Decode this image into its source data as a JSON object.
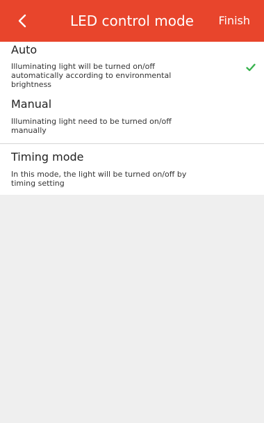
{
  "header": {
    "back_icon": "chevron-left-icon",
    "title": "LED control mode",
    "finish_label": "Finish",
    "background": "#e8452c"
  },
  "options": [
    {
      "title": "Auto",
      "description": "Illuminating light will be turned on/off automatically according to environmental brightness",
      "selected": true,
      "check_icon": "checkmark-icon",
      "check_color": "#37b24d"
    },
    {
      "title": "Manual",
      "description": "Illuminating light need to be turned on/off manually",
      "selected": false
    },
    {
      "title": "Timing mode",
      "description": "In this mode, the light will be turned on/off by timing setting",
      "selected": false
    }
  ]
}
